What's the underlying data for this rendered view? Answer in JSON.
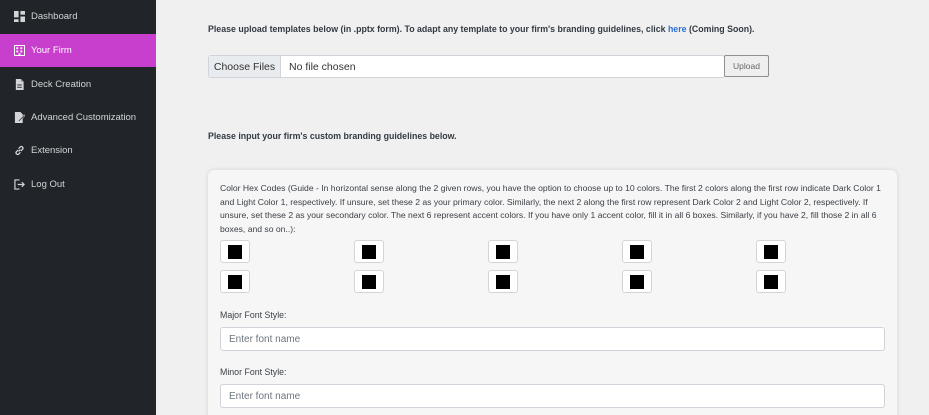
{
  "sidebar": {
    "items": [
      {
        "label": "Dashboard",
        "icon": "dashboard-icon"
      },
      {
        "label": "Your Firm",
        "icon": "building-icon",
        "active": true
      },
      {
        "label": "Deck Creation",
        "icon": "file-icon"
      },
      {
        "label": "Advanced Customization",
        "icon": "edit-file-icon"
      },
      {
        "label": "Extension",
        "icon": "link-icon"
      },
      {
        "label": "Log Out",
        "icon": "logout-icon"
      }
    ],
    "active_color": "#c93fcd",
    "bg_color": "#212529"
  },
  "templates": {
    "intro_prefix": "Please upload templates below (in .pptx form). To adapt any template to your firm's branding guidelines, click ",
    "intro_link": "here",
    "intro_suffix": " (Coming Soon).",
    "choose_files_label": "Choose Files",
    "file_status": "No file chosen",
    "upload_label": "Upload"
  },
  "branding": {
    "title": "Please input your firm's custom branding guidelines below.",
    "guide_text": "Color Hex Codes (Guide - In horizontal sense along the 2 given rows, you have the option to choose up to 10 colors. The first 2 colors along the first row indicate Dark Color 1 and Light Color 1, respectively. If unsure, set these 2 as your primary color. Similarly, the next 2 along the first row represent Dark Color 2 and Light Color 2, respectively. If unsure, set these 2 as your secondary color. The next 6 represent accent colors. If you have only 1 accent color, fill it in all 6 boxes. Similarly, if you have 2, fill those 2 in all 6 boxes, and so on..):",
    "colors": [
      "#000000",
      "#000000",
      "#000000",
      "#000000",
      "#000000",
      "#000000",
      "#000000",
      "#000000",
      "#000000",
      "#000000"
    ],
    "major_font_label": "Major Font Style:",
    "major_font_placeholder": "Enter font name",
    "minor_font_label": "Minor Font Style:",
    "minor_font_placeholder": "Enter font name"
  }
}
